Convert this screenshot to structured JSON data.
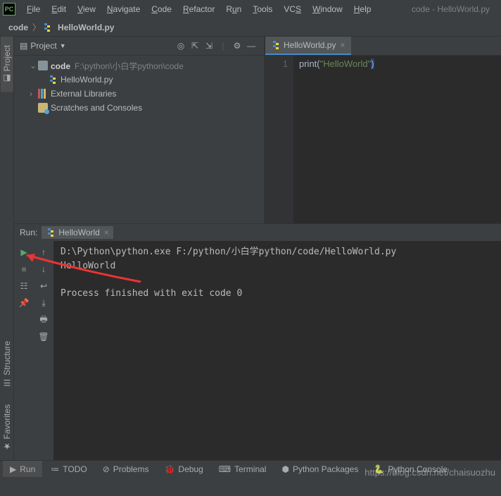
{
  "window": {
    "title": "code - HelloWorld.py"
  },
  "menu": [
    "File",
    "Edit",
    "View",
    "Navigate",
    "Code",
    "Refactor",
    "Run",
    "Tools",
    "VCS",
    "Window",
    "Help"
  ],
  "breadcrumb": {
    "root": "code",
    "file": "HelloWorld.py"
  },
  "project": {
    "panel_title": "Project",
    "root": {
      "name": "code",
      "path": "F:\\python\\小白学python\\code"
    },
    "file": "HelloWorld.py",
    "ext_libs": "External Libraries",
    "scratches": "Scratches and Consoles"
  },
  "editor": {
    "tab": "HelloWorld.py",
    "line_no": "1",
    "code": {
      "fn": "print",
      "lp": "(",
      "str": "\"HelloWorld\"",
      "rp": ")"
    }
  },
  "run": {
    "label": "Run:",
    "tab": "HelloWorld",
    "output": "D:\\Python\\python.exe F:/python/小白学python/code/HelloWorld.py\nHelloWorld\n\nProcess finished with exit code 0"
  },
  "rails": {
    "project": "Project",
    "structure": "Structure",
    "favorites": "Favorites"
  },
  "bottom": {
    "run": "Run",
    "todo": "TODO",
    "problems": "Problems",
    "debug": "Debug",
    "terminal": "Terminal",
    "pypkg": "Python Packages",
    "pycon": "Python Console"
  },
  "watermark": "https://blog.csdn.net/chaisuozhu"
}
